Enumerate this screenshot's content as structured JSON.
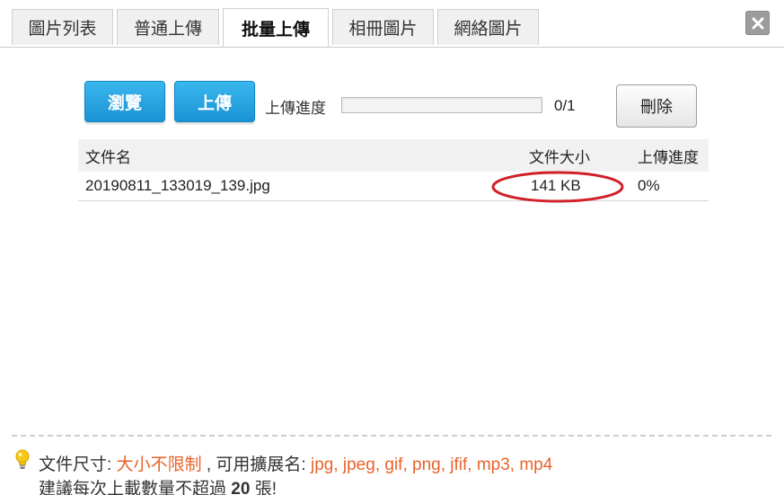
{
  "tabs": [
    {
      "label": "圖片列表"
    },
    {
      "label": "普通上傳"
    },
    {
      "label": "批量上傳"
    },
    {
      "label": "相冊圖片"
    },
    {
      "label": "網絡圖片"
    }
  ],
  "active_tab": "批量上傳",
  "close_icon": "close-icon",
  "toolbar": {
    "browse_label": "瀏覽",
    "upload_label": "上傳",
    "progress_label": "上傳進度",
    "progress_fraction": 0,
    "progress_count": "0/1",
    "delete_label": "刪除"
  },
  "table": {
    "headers": {
      "name": "文件名",
      "size": "文件大小",
      "progress": "上傳進度"
    },
    "rows": [
      {
        "name": "20190811_133019_139.jpg",
        "size": "141 KB",
        "progress": "0%"
      }
    ]
  },
  "footer": {
    "size_label": "文件尺寸: ",
    "size_value": "大小不限制",
    "ext_label": " , 可用擴展名: ",
    "ext_value": "jpg, jpeg, gif, png, jfif, mp3, mp4",
    "advice_prefix": "建議每次上載數量不超過 ",
    "advice_count": "20",
    "advice_suffix": " 張!"
  },
  "colors": {
    "accent_blue": "#1a94d4",
    "highlight_orange": "#e8632b",
    "annotation_red": "#d0202a"
  }
}
